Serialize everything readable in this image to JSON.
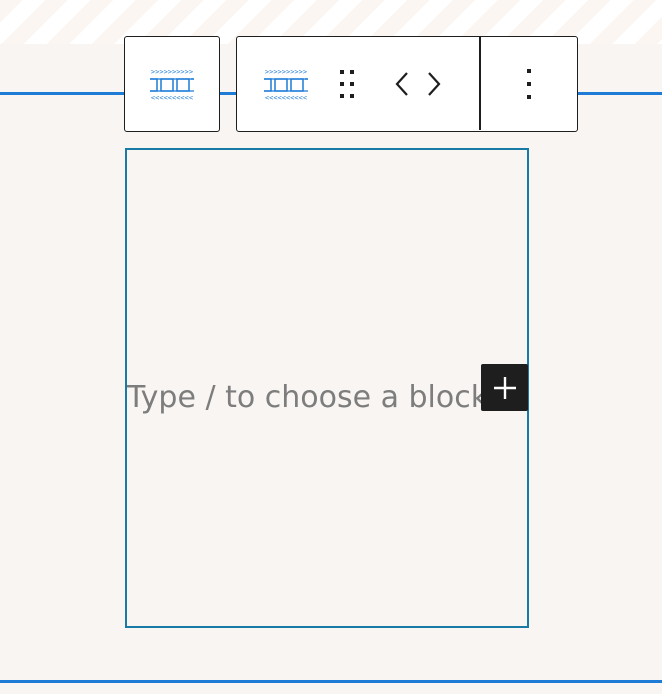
{
  "editor": {
    "placeholder": "Type / to choose a block",
    "inserter_label": "Add block"
  },
  "toolbar": {
    "parent_icon": "marquee-icon",
    "block_icon": "marquee-icon",
    "drag_icon": "drag-handle-icon",
    "move_left_icon": "chevron-left-icon",
    "move_right_icon": "chevron-right-icon",
    "options_icon": "more-vertical-icon"
  },
  "colors": {
    "accent": "#1e7bd6",
    "block_border": "#1a7aa6",
    "toolbar_border": "#1e1e1e",
    "background": "#f9f5f2",
    "inserter_bg": "#1e1e1e"
  }
}
